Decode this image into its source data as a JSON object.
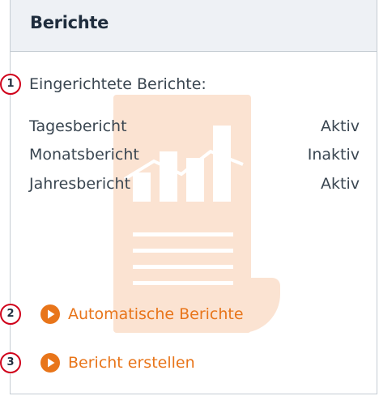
{
  "panel": {
    "title": "Berichte"
  },
  "reports": {
    "heading": "Eingerichtete Berichte:",
    "items": [
      {
        "name": "Tagesbericht",
        "status": "Aktiv"
      },
      {
        "name": "Monatsbericht",
        "status": "Inaktiv"
      },
      {
        "name": "Jahresbericht",
        "status": "Aktiv"
      }
    ]
  },
  "actions": {
    "automatic_reports": "Automatische Berichte",
    "create_report": "Bericht erstellen"
  },
  "callouts": [
    "1",
    "2",
    "3"
  ],
  "colors": {
    "accent": "#e8751a",
    "callout_border": "#d0021b",
    "header_bg": "#eef1f5",
    "text": "#3a4651",
    "watermark": "#fbe3d2"
  },
  "icons": {
    "watermark": "report-chart-icon",
    "link": "play-circle-icon"
  }
}
